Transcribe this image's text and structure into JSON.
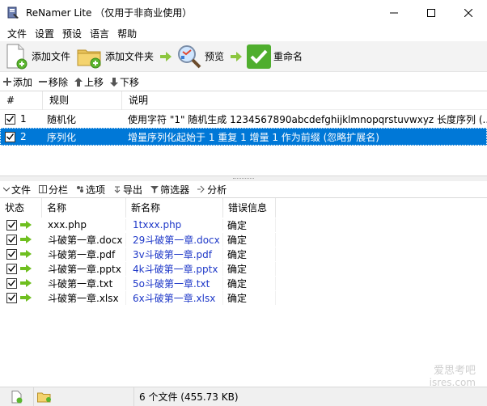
{
  "window": {
    "title": "ReNamer Lite （仅用于非商业使用）"
  },
  "menu": [
    "文件",
    "设置",
    "预设",
    "语言",
    "帮助"
  ],
  "toolbar": {
    "add_files": "添加文件",
    "add_folders": "添加文件夹",
    "preview": "预览",
    "rename": "重命名"
  },
  "rule_toolbar": {
    "add": "添加",
    "remove": "移除",
    "up": "上移",
    "down": "下移"
  },
  "rules": {
    "headers": [
      "#",
      "规则",
      "说明"
    ],
    "rows": [
      {
        "num": "1",
        "rule": "随机化",
        "desc": "使用字符 \"1\" 随机生成 1234567890abcdefghijklmnopqrstuvwxyz 长度序列 (...",
        "checked": true
      },
      {
        "num": "2",
        "rule": "序列化",
        "desc": "增量序列化起始于 1 重复 1 增量 1 作为前缀 (忽略扩展名)",
        "checked": true
      }
    ]
  },
  "file_toolbar": {
    "files": "文件",
    "columns": "分栏",
    "options": "选项",
    "export": "导出",
    "filter": "筛选器",
    "analyze": "分析"
  },
  "files": {
    "headers": [
      "状态",
      "名称",
      "新名称",
      "错误信息"
    ],
    "rows": [
      {
        "name": "xxx.php",
        "new": "1txxx.php",
        "err": "确定"
      },
      {
        "name": "斗破第一章.docx",
        "new": "29斗破第一章.docx",
        "err": "确定"
      },
      {
        "name": "斗破第一章.pdf",
        "new": "3v斗破第一章.pdf",
        "err": "确定"
      },
      {
        "name": "斗破第一章.pptx",
        "new": "4k斗破第一章.pptx",
        "err": "确定"
      },
      {
        "name": "斗破第一章.txt",
        "new": "5o斗破第一章.txt",
        "err": "确定"
      },
      {
        "name": "斗破第一章.xlsx",
        "new": "6x斗破第一章.xlsx",
        "err": "确定"
      }
    ]
  },
  "status": {
    "summary": "6 个文件 (455.73 KB)"
  },
  "watermark": {
    "line1": "爱思考吧",
    "line2": "isres.com"
  },
  "colors": {
    "selection": "#0078d7",
    "new_name": "#1e38c8",
    "arrow_green": "#6fbf1f"
  }
}
